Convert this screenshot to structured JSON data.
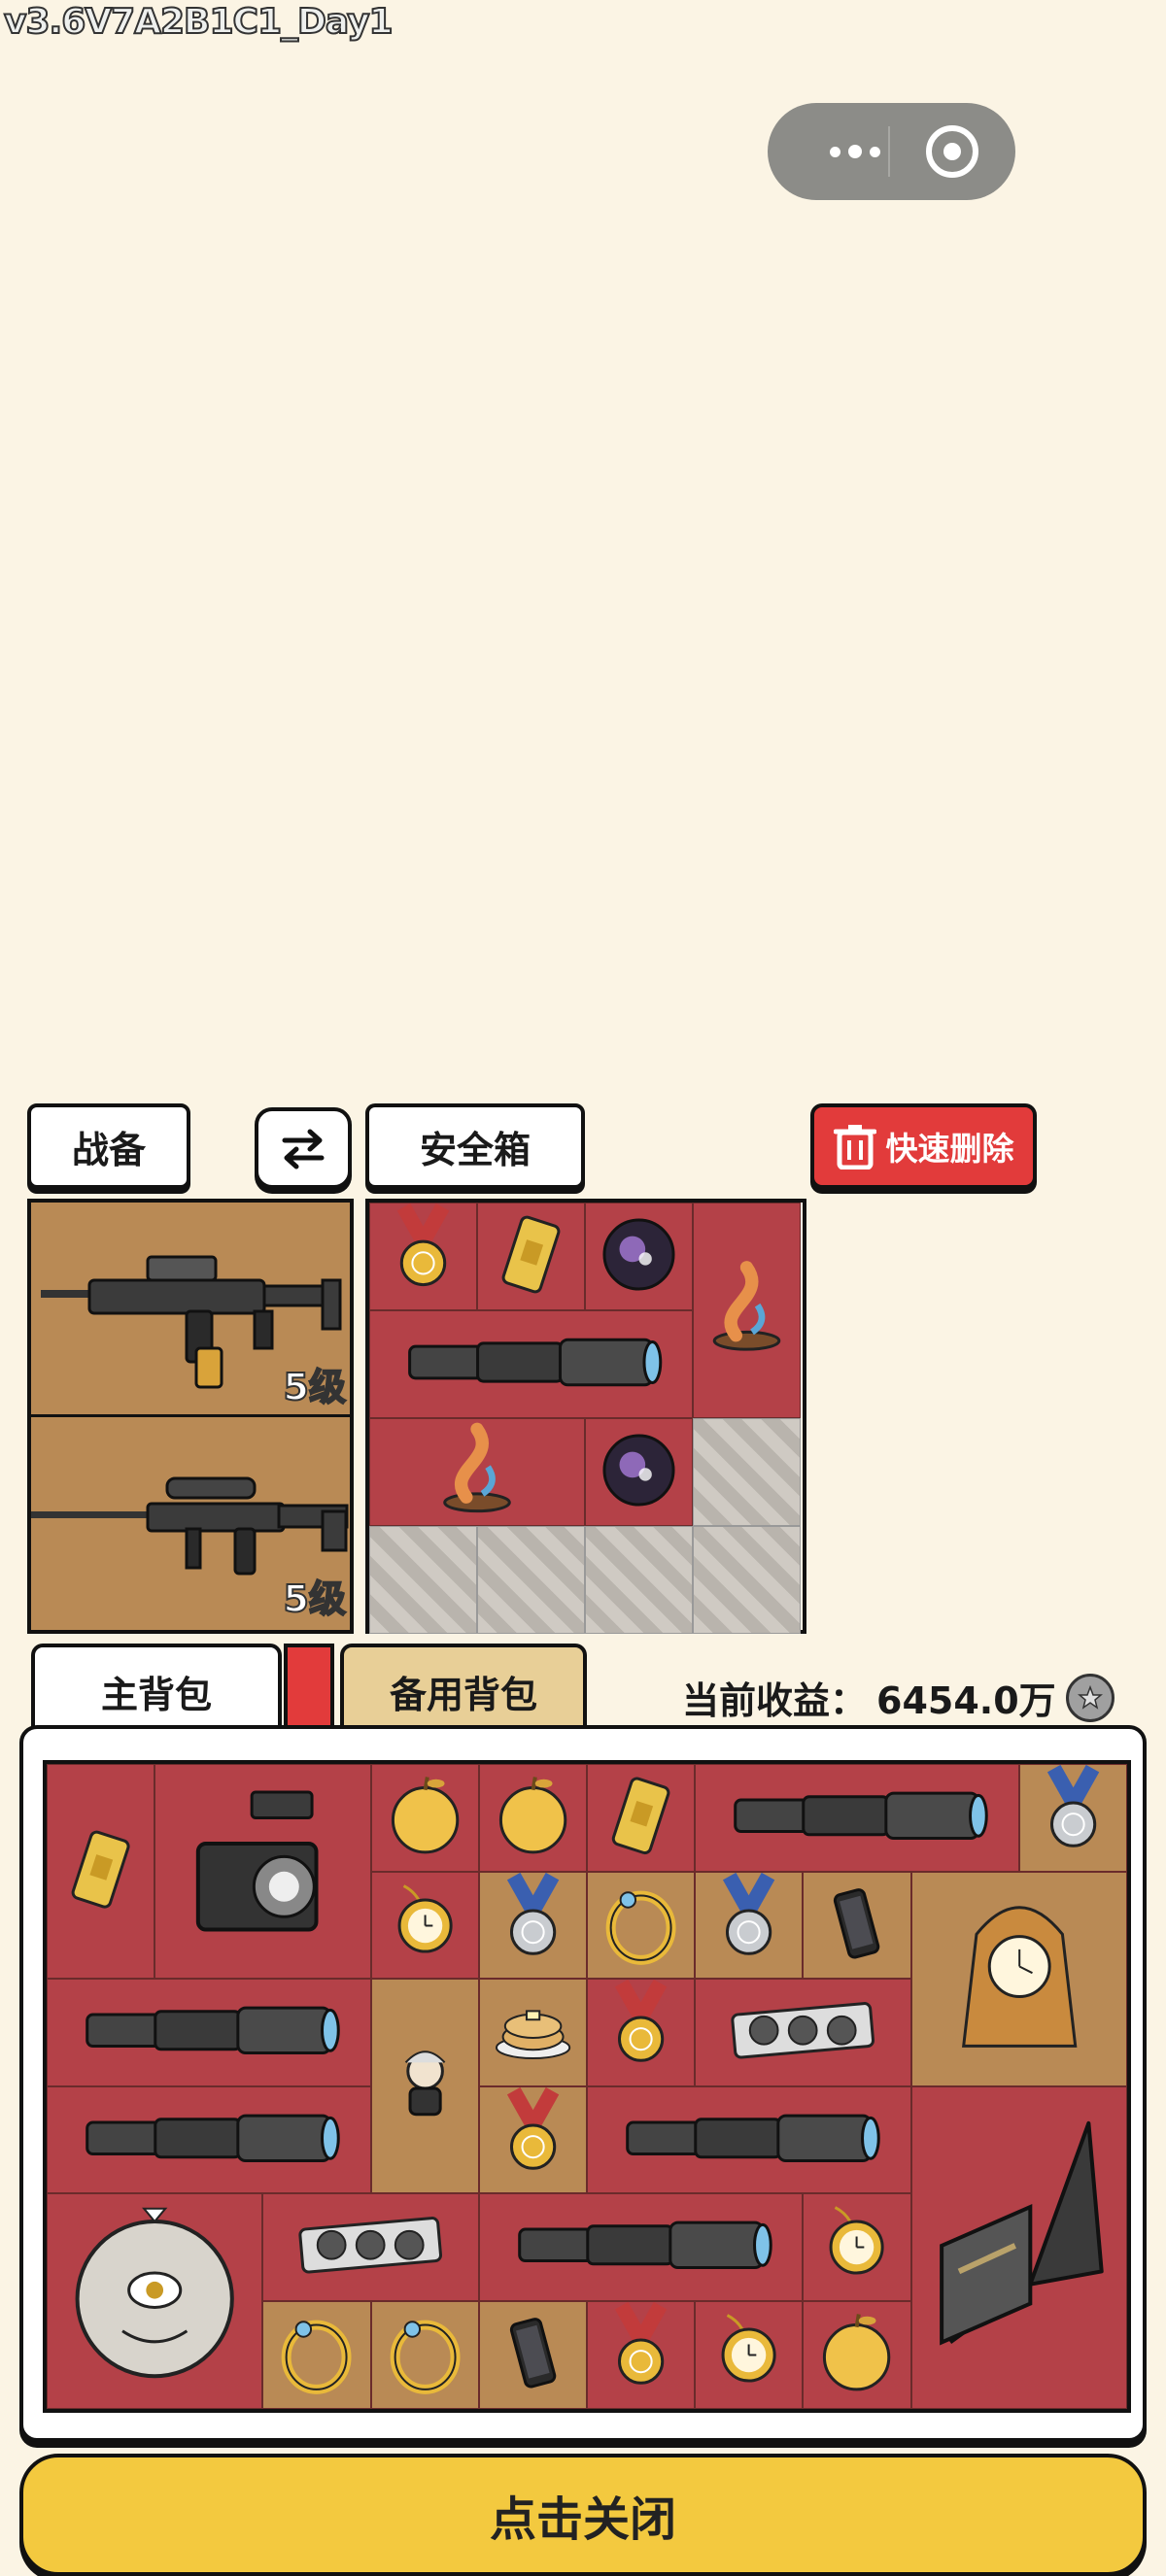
{
  "version": "v3.6V7A2B1C1_Day1",
  "buttons": {
    "gear": "战备",
    "safe_box": "安全箱",
    "quick_delete": "快速删除",
    "close": "点击关闭"
  },
  "weapons": [
    {
      "icon": "assault-rifle",
      "level": "5级"
    },
    {
      "icon": "sniper-rifle",
      "level": "5级"
    }
  ],
  "tabs": {
    "main_bag": "主背包",
    "backup_bag": "备用背包"
  },
  "earnings": {
    "label": "当前收益：",
    "value": "6454.0万"
  },
  "colors": {
    "background": "#fbf4e4",
    "slot_red": "#b44148",
    "slot_tan": "#b98a55",
    "close_yellow": "#f3c93f",
    "delete_red": "#e23b3b"
  },
  "safe_box_items": [
    {
      "icon": "gold-medal"
    },
    {
      "icon": "gold-bar"
    },
    {
      "icon": "purple-orb"
    },
    {
      "icon": "koi-statue"
    },
    {
      "icon": "telescope"
    },
    {
      "icon": "koi-statue"
    },
    {
      "icon": "purple-orb"
    }
  ],
  "bag_items": [
    {
      "icon": "gold-bar"
    },
    {
      "icon": "camera"
    },
    {
      "icon": "golden-apple"
    },
    {
      "icon": "golden-apple"
    },
    {
      "icon": "gold-bar"
    },
    {
      "icon": "telescope"
    },
    {
      "icon": "silver-medal"
    },
    {
      "icon": "pocket-watch"
    },
    {
      "icon": "silver-medal"
    },
    {
      "icon": "gold-ring"
    },
    {
      "icon": "silver-medal"
    },
    {
      "icon": "smartphone"
    },
    {
      "icon": "antique-clock"
    },
    {
      "icon": "telescope"
    },
    {
      "icon": "old-man-figure"
    },
    {
      "icon": "pancakes"
    },
    {
      "icon": "gold-medal"
    },
    {
      "icon": "graphics-card"
    },
    {
      "icon": "telescope"
    },
    {
      "icon": "gold-medal"
    },
    {
      "icon": "telescope"
    },
    {
      "icon": "laptop"
    },
    {
      "icon": "demon-mask"
    },
    {
      "icon": "graphics-card"
    },
    {
      "icon": "telescope"
    },
    {
      "icon": "pocket-watch"
    },
    {
      "icon": "gold-ring"
    },
    {
      "icon": "gold-ring"
    },
    {
      "icon": "smartphone"
    },
    {
      "icon": "gold-medal"
    },
    {
      "icon": "pocket-watch"
    },
    {
      "icon": "golden-apple"
    }
  ]
}
